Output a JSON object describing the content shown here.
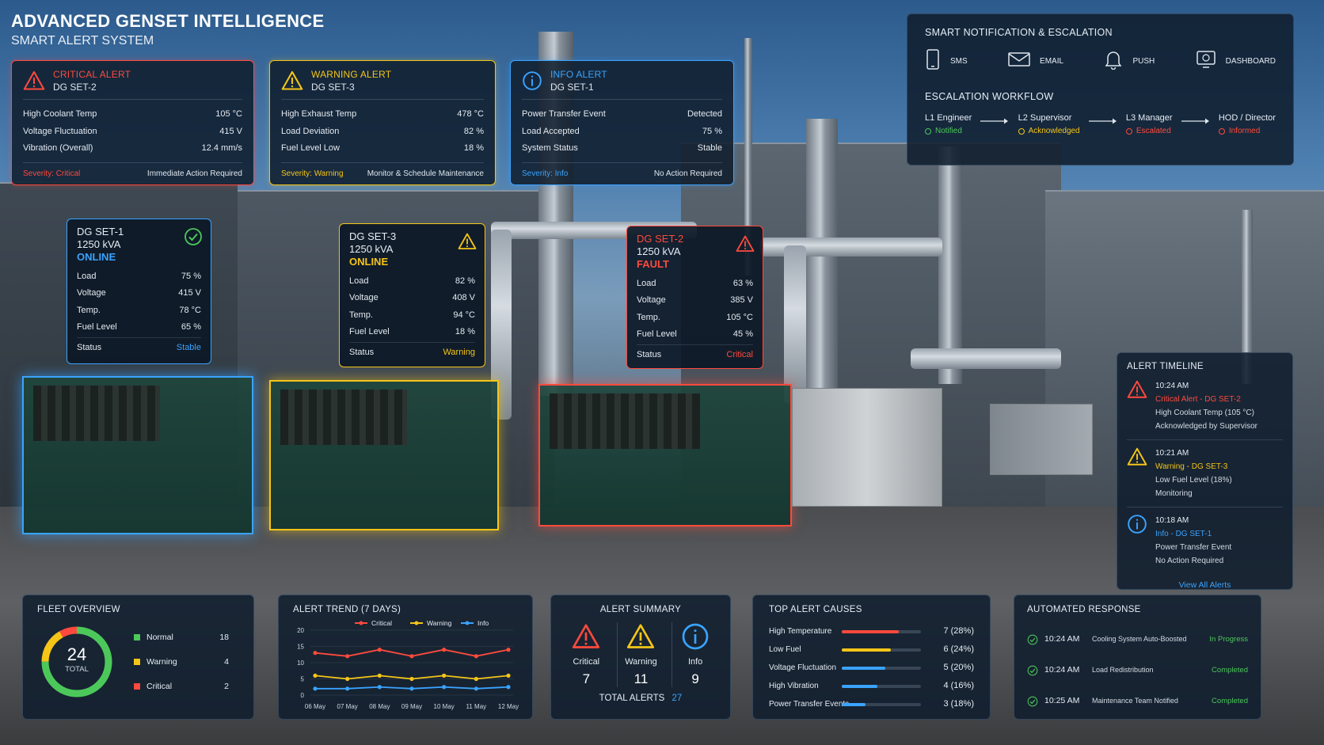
{
  "header": {
    "title": "ADVANCED GENSET INTELLIGENCE",
    "subtitle": "SMART ALERT SYSTEM"
  },
  "alert_cards": [
    {
      "type": "CRITICAL ALERT",
      "unit": "DG SET-2",
      "color": "#ff4a3d",
      "rows": [
        [
          "High Coolant Temp",
          "105 °C"
        ],
        [
          "Voltage Fluctuation",
          "415 V"
        ],
        [
          "Vibration (Overall)",
          "12.4 mm/s"
        ]
      ],
      "severity_label": "Severity:",
      "severity": "Critical",
      "action": "Immediate Action Required"
    },
    {
      "type": "WARNING ALERT",
      "unit": "DG SET-3",
      "color": "#f5c518",
      "rows": [
        [
          "High Exhaust Temp",
          "478 °C"
        ],
        [
          "Load Deviation",
          "82 %"
        ],
        [
          "Fuel Level Low",
          "18 %"
        ]
      ],
      "severity_label": "Severity:",
      "severity": "Warning",
      "action": "Monitor & Schedule Maintenance"
    },
    {
      "type": "INFO ALERT",
      "unit": "DG SET-1",
      "color": "#3aa3ff",
      "rows": [
        [
          "Power Transfer Event",
          "Detected"
        ],
        [
          "Load Accepted",
          "75 %"
        ],
        [
          "System Status",
          "Stable"
        ]
      ],
      "severity_label": "Severity:",
      "severity": "Info",
      "action": "No Action Required"
    }
  ],
  "notification": {
    "title": "SMART NOTIFICATION & ESCALATION",
    "channels": [
      {
        "label": "SMS",
        "icon": "phone-icon"
      },
      {
        "label": "EMAIL",
        "icon": "email-icon"
      },
      {
        "label": "PUSH",
        "icon": "bell-icon"
      },
      {
        "label": "DASHBOARD",
        "icon": "dashboard-icon"
      }
    ],
    "workflow_title": "ESCALATION WORKFLOW",
    "steps": [
      {
        "role": "L1 Engineer",
        "status": "Notified",
        "color": "#4cc85a"
      },
      {
        "role": "L2 Supervisor",
        "status": "Acknowledged",
        "color": "#f5c518"
      },
      {
        "role": "L3 Manager",
        "status": "Escalated",
        "color": "#ff4a3d"
      },
      {
        "role": "HOD / Director",
        "status": "Informed",
        "color": "#ff4a3d"
      }
    ]
  },
  "sets": [
    {
      "name": "DG SET-1",
      "rating": "1250 kVA",
      "state": "ONLINE",
      "color": "#3aa3ff",
      "icon": "check-circle-icon",
      "name_color": "#e6edf5",
      "rows": [
        [
          "Load",
          "75 %"
        ],
        [
          "Voltage",
          "415 V"
        ],
        [
          "Temp.",
          "78 °C"
        ],
        [
          "Fuel Level",
          "65 %"
        ]
      ],
      "status_label": "Status",
      "status": "Stable"
    },
    {
      "name": "DG SET-3",
      "rating": "1250 kVA",
      "state": "ONLINE",
      "color": "#f5c518",
      "icon": "warning-icon",
      "name_color": "#e6edf5",
      "rows": [
        [
          "Load",
          "82 %"
        ],
        [
          "Voltage",
          "408 V"
        ],
        [
          "Temp.",
          "94 °C"
        ],
        [
          "Fuel Level",
          "18 %"
        ]
      ],
      "status_label": "Status",
      "status": "Warning"
    },
    {
      "name": "DG SET-2",
      "rating": "1250 kVA",
      "state": "FAULT",
      "color": "#ff4a3d",
      "icon": "warning-icon",
      "name_color": "#ff4a3d",
      "rows": [
        [
          "Load",
          "63 %"
        ],
        [
          "Voltage",
          "385 V"
        ],
        [
          "Temp.",
          "105 °C"
        ],
        [
          "Fuel Level",
          "45 %"
        ]
      ],
      "status_label": "Status",
      "status": "Critical"
    }
  ],
  "timeline": {
    "title": "ALERT TIMELINE",
    "items": [
      {
        "time": "10:24 AM",
        "head": "Critical Alert - DG SET-2",
        "detail": "High Coolant Temp (105 °C)",
        "note": "Acknowledged by Supervisor",
        "color": "#ff4a3d",
        "icon": "warning-icon"
      },
      {
        "time": "10:21 AM",
        "head": "Warning - DG SET-3",
        "detail": "Low Fuel Level (18%)",
        "note": "Monitoring",
        "color": "#f5c518",
        "icon": "warning-icon"
      },
      {
        "time": "10:18 AM",
        "head": "Info - DG SET-1",
        "detail": "Power Transfer Event",
        "note": "No Action Required",
        "color": "#3aa3ff",
        "icon": "info-icon"
      }
    ],
    "link": "View All Alerts"
  },
  "fleet": {
    "title": "FLEET OVERVIEW",
    "total": "24",
    "total_label": "TOTAL",
    "items": [
      {
        "label": "Normal",
        "value": 18,
        "color": "#4cc85a"
      },
      {
        "label": "Warning",
        "value": 4,
        "color": "#f5c518"
      },
      {
        "label": "Critical",
        "value": 2,
        "color": "#ff4a3d"
      }
    ]
  },
  "trend": {
    "title": "ALERT TREND (7 DAYS)"
  },
  "chart_data": {
    "type": "line",
    "title": "ALERT TREND (7 DAYS)",
    "x": [
      "06 May",
      "07 May",
      "08 May",
      "09 May",
      "10 May",
      "11 May",
      "12 May"
    ],
    "ylim": [
      0,
      20
    ],
    "yticks": [
      0,
      5,
      10,
      15,
      20
    ],
    "legend_position": "top",
    "series": [
      {
        "name": "Critical",
        "color": "#ff4a3d",
        "values": [
          13,
          12,
          14,
          12,
          14,
          12,
          14
        ]
      },
      {
        "name": "Warning",
        "color": "#f5c518",
        "values": [
          6,
          5,
          6,
          5,
          6,
          5,
          6
        ]
      },
      {
        "name": "Info",
        "color": "#3aa3ff",
        "values": [
          2,
          2,
          2.5,
          2,
          2.5,
          2,
          2.5
        ]
      }
    ]
  },
  "summary": {
    "title": "ALERT SUMMARY",
    "items": [
      {
        "label": "Critical",
        "value": "7",
        "color": "#ff4a3d",
        "icon": "warning-icon"
      },
      {
        "label": "Warning",
        "value": "11",
        "color": "#f5c518",
        "icon": "warning-icon"
      },
      {
        "label": "Info",
        "value": "9",
        "color": "#3aa3ff",
        "icon": "info-icon"
      }
    ],
    "total_label": "TOTAL ALERTS",
    "total": "27"
  },
  "causes": {
    "title": "TOP ALERT CAUSES",
    "items": [
      {
        "label": "High Temperature",
        "value": "7 (28%)",
        "pct": 0.72,
        "color": "#ff4a3d"
      },
      {
        "label": "Low Fuel",
        "value": "6 (24%)",
        "pct": 0.62,
        "color": "#f5c518"
      },
      {
        "label": "Voltage Fluctuation",
        "value": "5 (20%)",
        "pct": 0.55,
        "color": "#3aa3ff"
      },
      {
        "label": "High Vibration",
        "value": "4 (16%)",
        "pct": 0.45,
        "color": "#3aa3ff"
      },
      {
        "label": "Power Transfer Events",
        "value": "3 (18%)",
        "pct": 0.3,
        "color": "#3aa3ff"
      }
    ]
  },
  "response": {
    "title": "AUTOMATED RESPONSE",
    "items": [
      {
        "time": "10:24 AM",
        "text": "Cooling System Auto-Boosted",
        "status": "In Progress"
      },
      {
        "time": "10:24 AM",
        "text": "Load Redistribution",
        "status": "Completed"
      },
      {
        "time": "10:25 AM",
        "text": "Maintenance Team Notified",
        "status": "Completed"
      }
    ],
    "color": "#4cc85a"
  }
}
